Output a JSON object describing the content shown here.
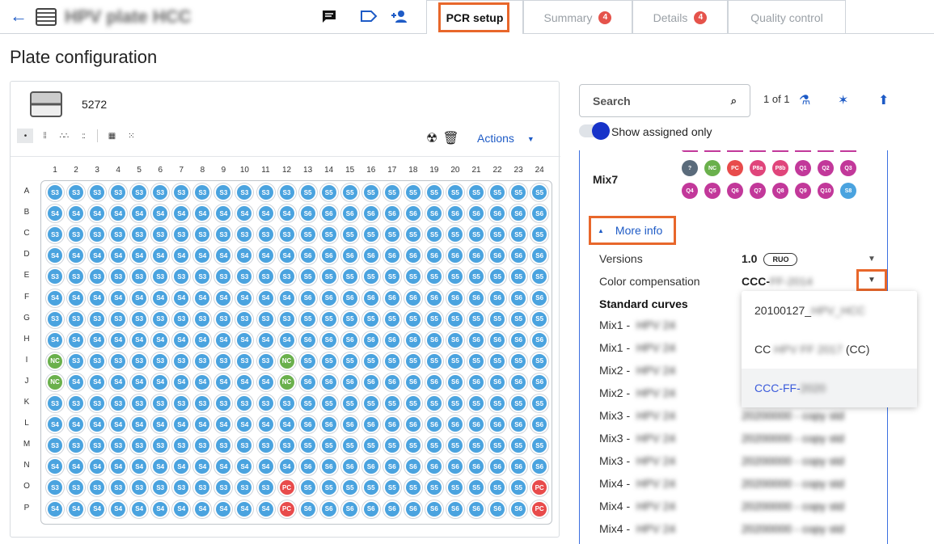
{
  "header": {
    "title": "HPV plate HCC",
    "tabs": [
      {
        "label": "PCR setup",
        "badge": "",
        "active": true
      },
      {
        "label": "Summary",
        "badge": "4"
      },
      {
        "label": "Details",
        "badge": "4"
      },
      {
        "label": "Quality control",
        "badge": ""
      }
    ]
  },
  "page_title": "Plate configuration",
  "plate": {
    "id": "5272",
    "actions_label": "Actions",
    "columns": [
      "1",
      "2",
      "3",
      "4",
      "5",
      "6",
      "7",
      "8",
      "9",
      "10",
      "11",
      "12",
      "13",
      "14",
      "15",
      "16",
      "17",
      "18",
      "19",
      "20",
      "21",
      "22",
      "23",
      "24"
    ],
    "rows": [
      "A",
      "B",
      "C",
      "D",
      "E",
      "F",
      "G",
      "H",
      "I",
      "J",
      "K",
      "L",
      "M",
      "N",
      "O",
      "P"
    ],
    "wells": [
      [
        "S3",
        "S3",
        "S3",
        "S3",
        "S3",
        "S3",
        "S3",
        "S3",
        "S3",
        "S3",
        "S3",
        "S3",
        "S5",
        "S5",
        "S5",
        "S5",
        "S5",
        "S5",
        "S5",
        "S5",
        "S5",
        "S5",
        "S5",
        "S5"
      ],
      [
        "S4",
        "S4",
        "S4",
        "S4",
        "S4",
        "S4",
        "S4",
        "S4",
        "S4",
        "S4",
        "S4",
        "S4",
        "S6",
        "S6",
        "S6",
        "S6",
        "S6",
        "S6",
        "S6",
        "S6",
        "S6",
        "S6",
        "S6",
        "S6"
      ],
      [
        "S3",
        "S3",
        "S3",
        "S3",
        "S3",
        "S3",
        "S3",
        "S3",
        "S3",
        "S3",
        "S3",
        "S3",
        "S5",
        "S5",
        "S5",
        "S5",
        "S5",
        "S5",
        "S5",
        "S5",
        "S5",
        "S5",
        "S5",
        "S5"
      ],
      [
        "S4",
        "S4",
        "S4",
        "S4",
        "S4",
        "S4",
        "S4",
        "S4",
        "S4",
        "S4",
        "S4",
        "S4",
        "S6",
        "S6",
        "S6",
        "S6",
        "S6",
        "S6",
        "S6",
        "S6",
        "S6",
        "S6",
        "S6",
        "S6"
      ],
      [
        "S3",
        "S3",
        "S3",
        "S3",
        "S3",
        "S3",
        "S3",
        "S3",
        "S3",
        "S3",
        "S3",
        "S3",
        "S5",
        "S5",
        "S5",
        "S5",
        "S5",
        "S5",
        "S5",
        "S5",
        "S5",
        "S5",
        "S5",
        "S5"
      ],
      [
        "S4",
        "S4",
        "S4",
        "S4",
        "S4",
        "S4",
        "S4",
        "S4",
        "S4",
        "S4",
        "S4",
        "S4",
        "S6",
        "S6",
        "S6",
        "S6",
        "S6",
        "S6",
        "S6",
        "S6",
        "S6",
        "S6",
        "S6",
        "S6"
      ],
      [
        "S3",
        "S3",
        "S3",
        "S3",
        "S3",
        "S3",
        "S3",
        "S3",
        "S3",
        "S3",
        "S3",
        "S3",
        "S5",
        "S5",
        "S5",
        "S5",
        "S5",
        "S5",
        "S5",
        "S5",
        "S5",
        "S5",
        "S5",
        "S5"
      ],
      [
        "S4",
        "S4",
        "S4",
        "S4",
        "S4",
        "S4",
        "S4",
        "S4",
        "S4",
        "S4",
        "S4",
        "S4",
        "S6",
        "S6",
        "S6",
        "S6",
        "S6",
        "S6",
        "S6",
        "S6",
        "S6",
        "S6",
        "S6",
        "S6"
      ],
      [
        "NC",
        "S3",
        "S3",
        "S3",
        "S3",
        "S3",
        "S3",
        "S3",
        "S3",
        "S3",
        "S3",
        "NC",
        "S5",
        "S5",
        "S5",
        "S5",
        "S5",
        "S5",
        "S5",
        "S5",
        "S5",
        "S5",
        "S5",
        "S5"
      ],
      [
        "NC",
        "S4",
        "S4",
        "S4",
        "S4",
        "S4",
        "S4",
        "S4",
        "S4",
        "S4",
        "S4",
        "NC",
        "S6",
        "S6",
        "S6",
        "S6",
        "S6",
        "S6",
        "S6",
        "S6",
        "S6",
        "S6",
        "S6",
        "S6"
      ],
      [
        "S3",
        "S3",
        "S3",
        "S3",
        "S3",
        "S3",
        "S3",
        "S3",
        "S3",
        "S3",
        "S3",
        "S3",
        "S5",
        "S5",
        "S5",
        "S5",
        "S5",
        "S5",
        "S5",
        "S5",
        "S5",
        "S5",
        "S5",
        "S5"
      ],
      [
        "S4",
        "S4",
        "S4",
        "S4",
        "S4",
        "S4",
        "S4",
        "S4",
        "S4",
        "S4",
        "S4",
        "S4",
        "S6",
        "S6",
        "S6",
        "S6",
        "S6",
        "S6",
        "S6",
        "S6",
        "S6",
        "S6",
        "S6",
        "S6"
      ],
      [
        "S3",
        "S3",
        "S3",
        "S3",
        "S3",
        "S3",
        "S3",
        "S3",
        "S3",
        "S3",
        "S3",
        "S3",
        "S5",
        "S5",
        "S5",
        "S5",
        "S5",
        "S5",
        "S5",
        "S5",
        "S5",
        "S5",
        "S5",
        "S5"
      ],
      [
        "S4",
        "S4",
        "S4",
        "S4",
        "S4",
        "S4",
        "S4",
        "S4",
        "S4",
        "S4",
        "S4",
        "S4",
        "S6",
        "S6",
        "S6",
        "S6",
        "S6",
        "S6",
        "S6",
        "S6",
        "S6",
        "S6",
        "S6",
        "S6"
      ],
      [
        "S3",
        "S3",
        "S3",
        "S3",
        "S3",
        "S3",
        "S3",
        "S3",
        "S3",
        "S3",
        "S3",
        "PC",
        "S5",
        "S5",
        "S5",
        "S5",
        "S5",
        "S5",
        "S5",
        "S5",
        "S5",
        "S5",
        "S5",
        "PC"
      ],
      [
        "S4",
        "S4",
        "S4",
        "S4",
        "S4",
        "S4",
        "S4",
        "S4",
        "S4",
        "S4",
        "S4",
        "PC",
        "S6",
        "S6",
        "S6",
        "S6",
        "S6",
        "S6",
        "S6",
        "S6",
        "S6",
        "S6",
        "S6",
        "PC"
      ]
    ]
  },
  "search": {
    "placeholder": "Search"
  },
  "pager": "1 of 1",
  "toggle_label": "Show assigned only",
  "mix": {
    "name": "Mix7",
    "targets": [
      {
        "label": "?",
        "color": "#5a6b7b"
      },
      {
        "label": "NC",
        "color": "#6ab04c"
      },
      {
        "label": "PC",
        "color": "#e84b4b"
      },
      {
        "label": "P8a",
        "color": "#e0457b"
      },
      {
        "label": "P8b",
        "color": "#e0457b"
      },
      {
        "label": "Q1",
        "color": "#c2389a"
      },
      {
        "label": "Q2",
        "color": "#c2389a"
      },
      {
        "label": "Q3",
        "color": "#c2389a"
      },
      {
        "label": "Q4",
        "color": "#c2389a"
      },
      {
        "label": "Q5",
        "color": "#c2389a"
      },
      {
        "label": "Q6",
        "color": "#c2389a"
      },
      {
        "label": "Q7",
        "color": "#c2389a"
      },
      {
        "label": "Q8",
        "color": "#c2389a"
      },
      {
        "label": "Q9",
        "color": "#c2389a"
      },
      {
        "label": "Q10",
        "color": "#c2389a"
      },
      {
        "label": "S8",
        "color": "#4aa3df"
      }
    ]
  },
  "more_info_label": "More info",
  "info": {
    "versions_label": "Versions",
    "versions_value": "1.0",
    "ruo": "RUO",
    "cc_label": "Color compensation",
    "cc_value": "CCC-",
    "std_label": "Standard curves",
    "curves": [
      "Mix1 -",
      "Mix1 -",
      "Mix2 -",
      "Mix2 -",
      "Mix3 -",
      "Mix3 -",
      "Mix3 -",
      "Mix4 -",
      "Mix4 -",
      "Mix4 -"
    ]
  },
  "dropdown": {
    "options": [
      "20100127_",
      "CC",
      "CCC-FF-"
    ],
    "suffix": "(CC)"
  }
}
